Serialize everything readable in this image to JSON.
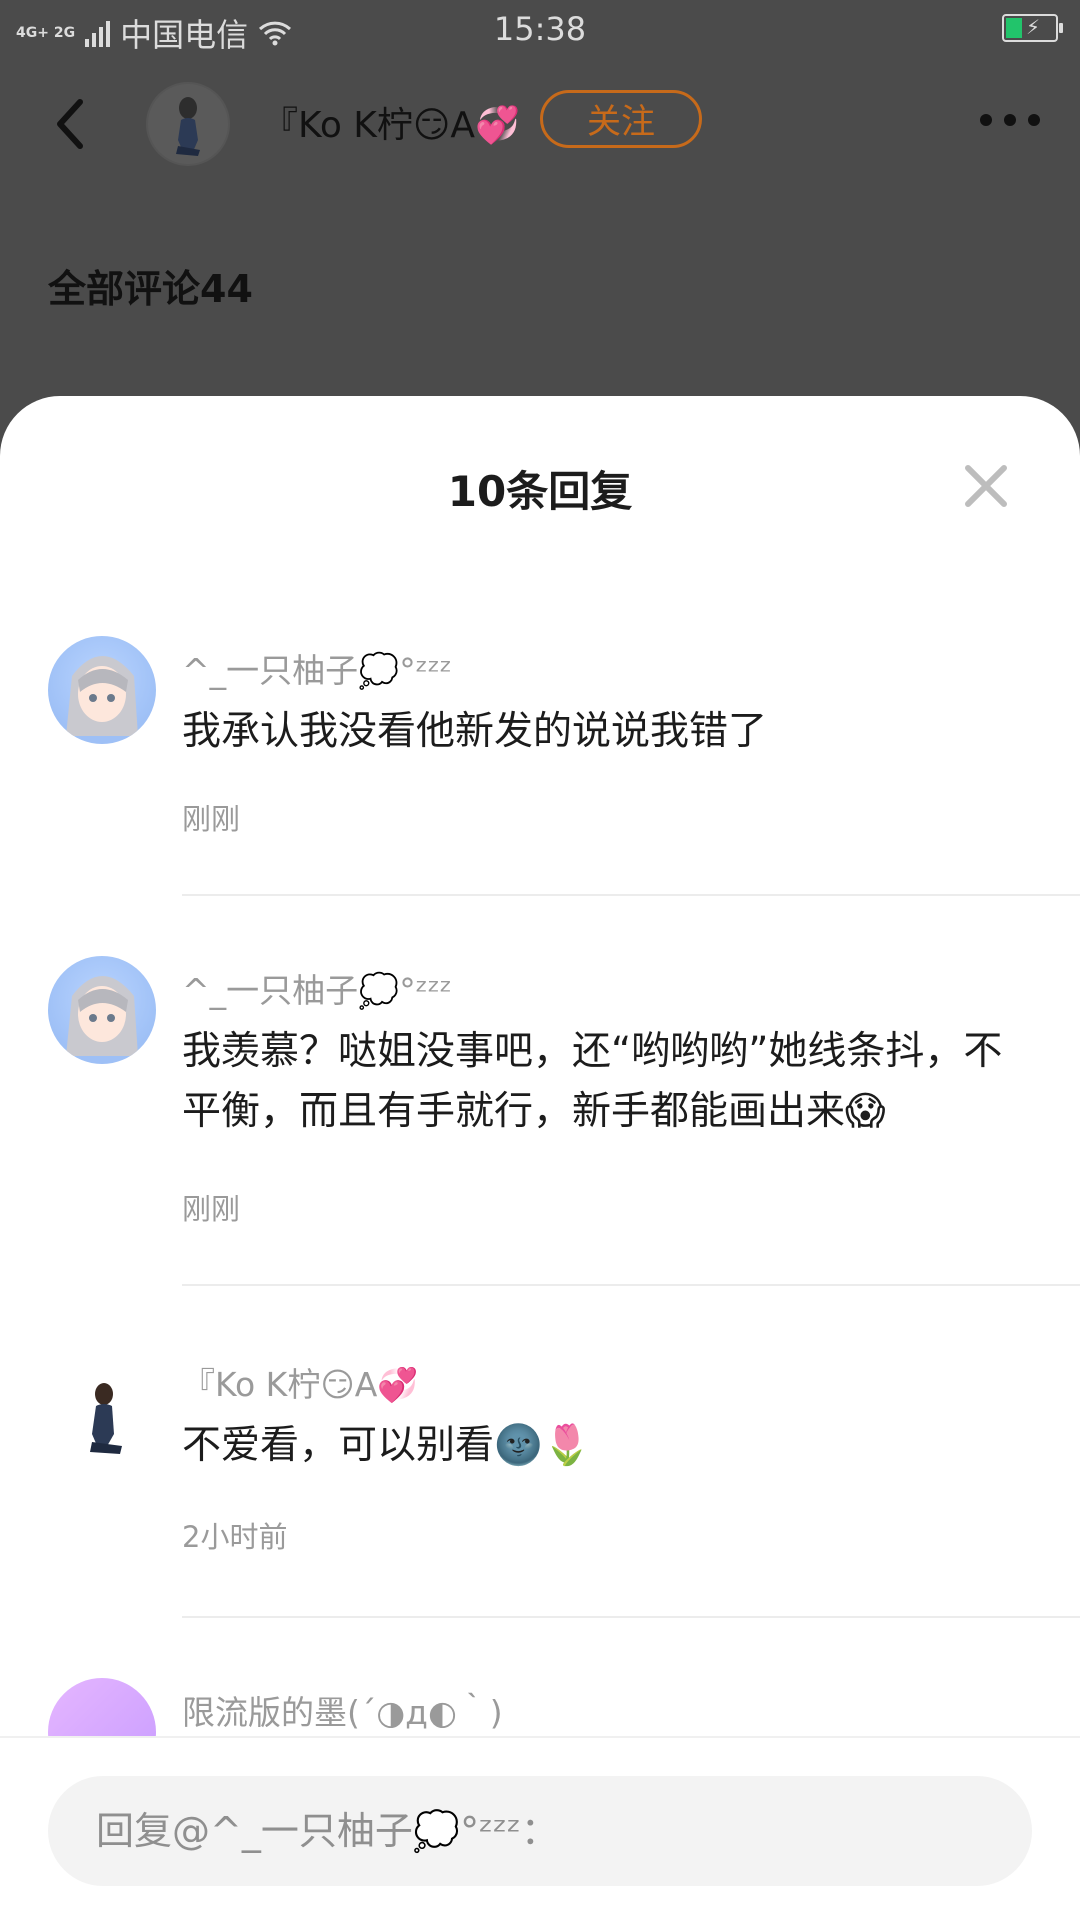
{
  "status_bar": {
    "network_type": "4G+ 2G",
    "carrier": "中国电信",
    "time": "15:38"
  },
  "post_header": {
    "author_name": "『Ko K柠😏A💞",
    "follow_label": "关注",
    "all_comments_label": "全部评论44"
  },
  "sheet": {
    "title": "10条回复",
    "replies": [
      {
        "username": "^_一只柚子💭°ᶻᶻᶻ",
        "content": "我承认我没看他新发的说说我错了",
        "time": "刚刚"
      },
      {
        "username": "^_一只柚子💭°ᶻᶻᶻ",
        "content": "我羡慕？哒姐没事吧，还“哟哟哟”她线条抖，不平衡，而且有手就行，新手都能画出来😱",
        "time": "刚刚"
      },
      {
        "username": "『Ko K柠😏A💞",
        "content": "不爱看，可以别看🌚🌷",
        "time": "2小时前"
      },
      {
        "username": "限流版的墨(´◑д◐｀)",
        "content": "",
        "time": ""
      }
    ]
  },
  "reply_input": {
    "placeholder": "回复@^_一只柚子💭°ᶻᶻᶻ："
  },
  "colors": {
    "follow_accent": "#c76a1a",
    "dim_overlay": "#4b4b4b",
    "battery_fill": "#22c46b"
  }
}
